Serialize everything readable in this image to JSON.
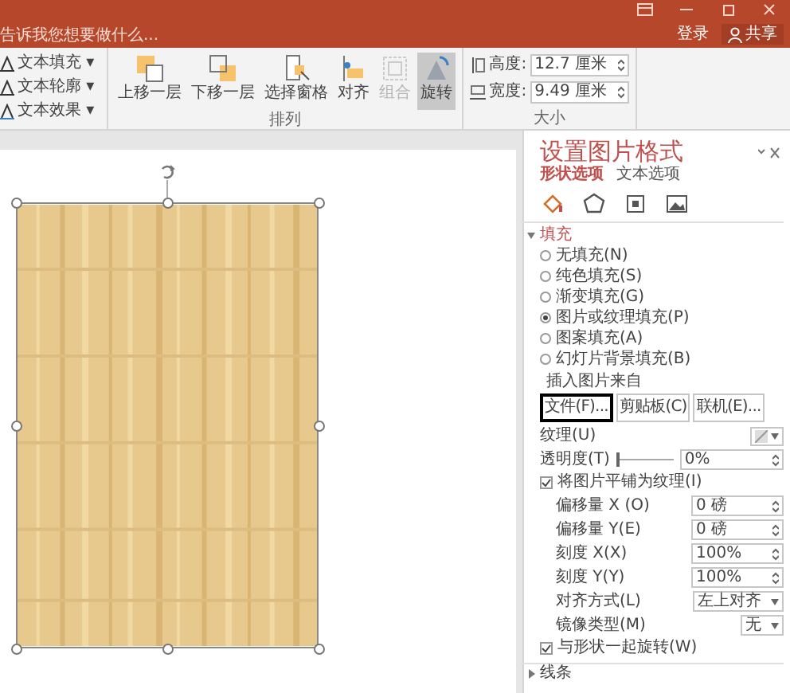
{
  "title_bar": {
    "tell_me": "告诉我您想要做什么...",
    "sign_in": "登录",
    "share": "共享"
  },
  "ribbon": {
    "groups": [
      {
        "items": [
          {
            "label": "文本填充",
            "caret": "▾"
          },
          {
            "label": "文本轮廓",
            "caret": "▾"
          },
          {
            "label": "文本效果",
            "caret": "▾"
          }
        ]
      },
      {
        "label": "排列",
        "buttons": [
          {
            "label": "上移一层",
            "disabled": false,
            "selected": false
          },
          {
            "label": "下移一层",
            "disabled": false,
            "selected": false
          },
          {
            "label": "选择窗格",
            "disabled": false,
            "selected": false
          },
          {
            "label": "对齐",
            "disabled": false,
            "selected": false
          },
          {
            "label": "组合",
            "disabled": true,
            "selected": false
          },
          {
            "label": "旋转",
            "disabled": false,
            "selected": true
          }
        ]
      },
      {
        "label": "大小",
        "fields": [
          {
            "label": "高度:",
            "value": "12.7 厘米"
          },
          {
            "label": "宽度:",
            "value": "9.49 厘米"
          }
        ]
      }
    ]
  },
  "pane": {
    "title": "设置图片格式",
    "tabs": [
      {
        "label": "形状选项",
        "selected": true
      },
      {
        "label": "文本选项",
        "selected": false
      }
    ],
    "icon_tabs": [
      {
        "selected": true
      },
      {
        "selected": false
      },
      {
        "selected": false
      },
      {
        "selected": false
      }
    ],
    "fill": {
      "label": "填充",
      "expanded": true,
      "options": [
        {
          "label": "无填充(N)",
          "selected": false
        },
        {
          "label": "纯色填充(S)",
          "selected": false
        },
        {
          "label": "渐变填充(G)",
          "selected": false
        },
        {
          "label": "图片或纹理填充(P)",
          "selected": true
        },
        {
          "label": "图案填充(A)",
          "selected": false
        },
        {
          "label": "幻灯片背景填充(B)",
          "selected": false
        }
      ],
      "insert_from": "插入图片来自",
      "insert_buttons": [
        {
          "label": "文件(F)...",
          "focused": true
        },
        {
          "label": "剪贴板(C)",
          "focused": false
        },
        {
          "label": "联机(E)...",
          "focused": false
        }
      ],
      "texture": "纹理(U)",
      "transparency": {
        "label": "透明度(T)",
        "level": 0,
        "value": "0%"
      },
      "tile": {
        "label": "将图片平铺为纹理(I)",
        "checked": true
      },
      "fields": [
        {
          "label": "偏移量 X (O)",
          "value": "0 磅",
          "kind": "spin"
        },
        {
          "label": "偏移量 Y(E)",
          "value": "0 磅",
          "kind": "spin"
        },
        {
          "label": "刻度 X(X)",
          "value": "100%",
          "kind": "spin"
        },
        {
          "label": "刻度 Y(Y)",
          "value": "100%",
          "kind": "spin"
        },
        {
          "label": "对齐方式(L)",
          "value": "左上对齐",
          "kind": "dropdown"
        },
        {
          "label": "镜像类型(M)",
          "value": "无",
          "kind": "dropdown"
        }
      ],
      "rotate": {
        "label": "与形状一起旋转(W)",
        "checked": true
      }
    },
    "line": {
      "label": "线条",
      "expanded": false
    }
  }
}
